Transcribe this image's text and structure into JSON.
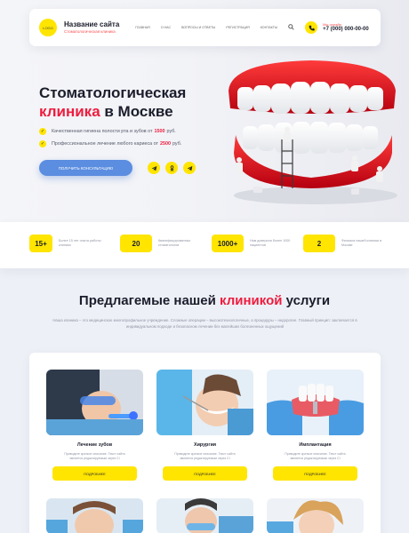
{
  "header": {
    "logo_text": "LOGO",
    "site_name": "Название сайта",
    "site_tagline": "Стоматологическая клиника",
    "nav": [
      "Главная",
      "О нас",
      "Вопросы и ответы",
      "Регистрация",
      "Контакты"
    ],
    "search_icon": "search-icon",
    "phone_label": "Мы онлайн",
    "phone": "+7 (000) 000-00-00"
  },
  "hero": {
    "title_line1": "Стоматологическая",
    "title_red": "клиника",
    "title_rest": " в Москве",
    "bullets": [
      {
        "pre": "Качественная гигиена полости рта и зубов от",
        "price": "1500",
        "post": "руб."
      },
      {
        "pre": "Профессиональное лечение любого кариеса от",
        "price": "2500",
        "post": "руб."
      }
    ],
    "cta": "Получить консультацию",
    "social": [
      "Telegram",
      "Одноклассники",
      "Telegram"
    ]
  },
  "stats": [
    {
      "value": "15+",
      "label": "Более 15 лет опыта работы клиники"
    },
    {
      "value": "20",
      "label": "Квалифицированных стоматологов"
    },
    {
      "value": "1000+",
      "label": "Нам доверили более 1000 пациентов"
    },
    {
      "value": "2",
      "label": "Филиала нашей клиники в Москве"
    }
  ],
  "services": {
    "title_pre": "Предлагемые нашей ",
    "title_red": "клиникой",
    "title_post": " услуги",
    "description": "Наша клиника – это медицинское многопрофильное учреждение. Сложные операции – высокотехнологичные, а процедуры – недорогие. Главный принцип: заключается в индивидуальном подходе и безопасном лечении без малейших болезненных ощущений",
    "cards": [
      {
        "title": "Лечение зубов",
        "text": "Приводите краткое описание. Текст сайта является редактируемым через CI",
        "button": "Подробнее"
      },
      {
        "title": "Хирургия",
        "text": "Приводите краткое описание. Текст сайта является редактируемым через CI",
        "button": "Подробнее"
      },
      {
        "title": "Имплантация",
        "text": "Приводите краткое описание. Текст сайта является редактируемым через CI",
        "button": "Подробнее"
      }
    ]
  },
  "colors": {
    "accent": "#ffe500",
    "red": "#ee1c3e",
    "blue": "#5b8de0"
  }
}
